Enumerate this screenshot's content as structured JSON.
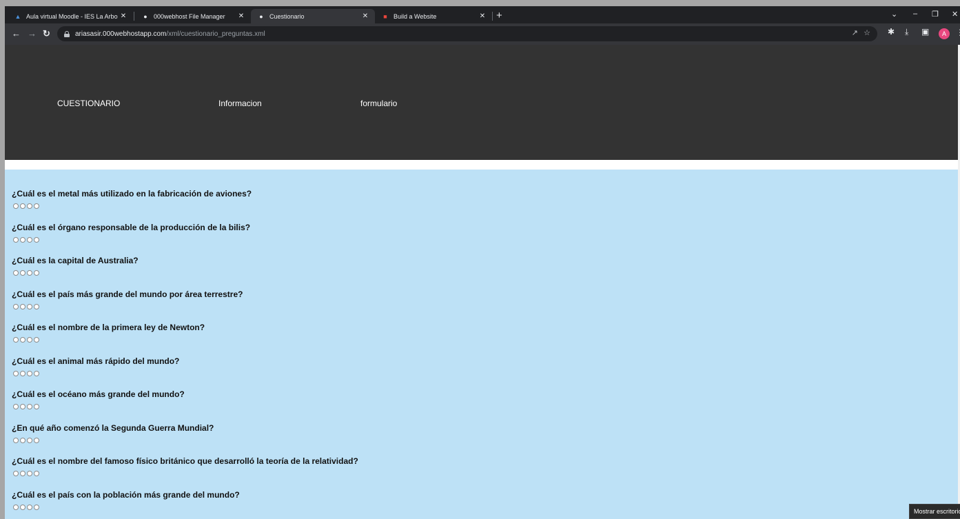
{
  "browser": {
    "tabs": [
      {
        "title": "Aula virtual Moodle - IES La Arbo",
        "icon": "moodle-icon",
        "active": false
      },
      {
        "title": "000webhost File Manager",
        "icon": "globe-icon",
        "active": false
      },
      {
        "title": "Cuestionario",
        "icon": "globe-icon",
        "active": true
      },
      {
        "title": "Build a Website",
        "icon": "webhost-logo-icon",
        "active": false
      }
    ],
    "new_tab_symbol": "+",
    "url_host": "ariasasir.000webhostapp.com",
    "url_path": "/xml/cuestionario_preguntas.xml",
    "profile_initial": "A"
  },
  "site_nav": {
    "items": [
      "CUESTIONARIO",
      "Informacion",
      "formulario"
    ]
  },
  "questions": [
    "¿Cuál es el metal más utilizado en la fabricación de aviones?",
    "¿Cuál es el órgano responsable de la producción de la bilis?",
    "¿Cuál es la capital de Australia?",
    "¿Cuál es el país más grande del mundo por área terrestre?",
    "¿Cuál es el nombre de la primera ley de Newton?",
    "¿Cuál es el animal más rápido del mundo?",
    "¿Cuál es el océano más grande del mundo?",
    "¿En qué año comenzó la Segunda Guerra Mundial?",
    "¿Cuál es el nombre del famoso físico británico que desarrolló la teoría de la relatividad?",
    "¿Cuál es el país con la población más grande del mundo?"
  ],
  "options_per_question": 4,
  "tooltip": "Mostrar escritorio",
  "colors": {
    "header_bg": "#333333",
    "content_bg": "#bde1f6",
    "chrome_bg": "#202124"
  }
}
